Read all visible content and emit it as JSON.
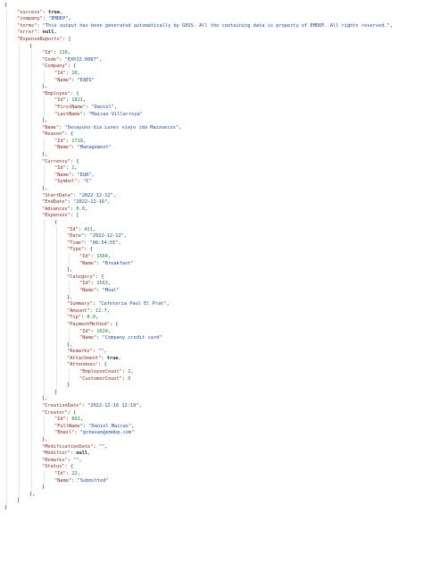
{
  "json_lines": [
    {
      "d": 0,
      "t": "{",
      "toggle": true
    },
    {
      "d": 1,
      "k": "success",
      "v": "true",
      "vt": "bool"
    },
    {
      "d": 1,
      "k": "company",
      "v": "\"EMDEP\"",
      "vt": "str"
    },
    {
      "d": 1,
      "k": "terms",
      "v": "\"This output has been generated automatically by GEOS. All the containing data is property of EMDEP. All rights reserved.\"",
      "vt": "str"
    },
    {
      "d": 1,
      "k": "error",
      "v": "null",
      "vt": "nul"
    },
    {
      "d": 1,
      "k": "ExpenseReports",
      "t": "[",
      "toggle": true
    },
    {
      "d": 2,
      "t": "{",
      "toggle": true
    },
    {
      "d": 3,
      "k": "Id",
      "v": "118",
      "vt": "num"
    },
    {
      "d": 3,
      "k": "Code",
      "v": "\"EXP22.0087\"",
      "vt": "str"
    },
    {
      "d": 3,
      "k": "Company",
      "t": "{",
      "toggle": true
    },
    {
      "d": 4,
      "k": "Id",
      "v": "10",
      "vt": "num"
    },
    {
      "d": 4,
      "k": "Name",
      "v": "\"EAES\"",
      "vt": "str",
      "last": true
    },
    {
      "d": 3,
      "t": "},"
    },
    {
      "d": 3,
      "k": "Employee",
      "t": "{",
      "toggle": true
    },
    {
      "d": 4,
      "k": "Id",
      "v": "1821",
      "vt": "num"
    },
    {
      "d": 4,
      "k": "FirstName",
      "v": "\"Daniel\"",
      "vt": "str"
    },
    {
      "d": 4,
      "k": "LastName",
      "v": "\"Maicas Villarroya\"",
      "vt": "str",
      "last": true
    },
    {
      "d": 3,
      "t": "},"
    },
    {
      "d": 3,
      "k": "Name",
      "v": "\"Desayuno dia Lunes viaje ida Mazzuecos\"",
      "vt": "str"
    },
    {
      "d": 3,
      "k": "Reason",
      "t": "{",
      "toggle": true
    },
    {
      "d": 4,
      "k": "Id",
      "v": "1719",
      "vt": "num"
    },
    {
      "d": 4,
      "k": "Name",
      "v": "\"Management\"",
      "vt": "str",
      "last": true
    },
    {
      "d": 3,
      "t": "},"
    },
    {
      "d": 3,
      "k": "Currency",
      "t": "{",
      "toggle": true
    },
    {
      "d": 4,
      "k": "Id",
      "v": "1",
      "vt": "num"
    },
    {
      "d": 4,
      "k": "Name",
      "v": "\"EUR\"",
      "vt": "str"
    },
    {
      "d": 4,
      "k": "Symbol",
      "v": "\"€\"",
      "vt": "str",
      "last": true
    },
    {
      "d": 3,
      "t": "},"
    },
    {
      "d": 3,
      "k": "StartDate",
      "v": "\"2022-12-12\"",
      "vt": "str"
    },
    {
      "d": 3,
      "k": "EndDate",
      "v": "\"2022-12-16\"",
      "vt": "str"
    },
    {
      "d": 3,
      "k": "Advances",
      "v": "0.0",
      "vt": "num"
    },
    {
      "d": 3,
      "k": "Expenses",
      "t": "[",
      "toggle": true
    },
    {
      "d": 4,
      "t": "{",
      "toggle": true
    },
    {
      "d": 5,
      "k": "Id",
      "v": "411",
      "vt": "num"
    },
    {
      "d": 5,
      "k": "Date",
      "v": "\"2022-12-12\"",
      "vt": "str"
    },
    {
      "d": 5,
      "k": "Time",
      "v": "\"06:54:55\"",
      "vt": "str"
    },
    {
      "d": 5,
      "k": "Type",
      "t": "{",
      "toggle": true
    },
    {
      "d": 6,
      "k": "Id",
      "v": "1564",
      "vt": "num"
    },
    {
      "d": 6,
      "k": "Name",
      "v": "\"Breakfast\"",
      "vt": "str",
      "last": true
    },
    {
      "d": 5,
      "t": "},"
    },
    {
      "d": 5,
      "k": "Category",
      "t": "{",
      "toggle": true
    },
    {
      "d": 6,
      "k": "Id",
      "v": "1563",
      "vt": "num"
    },
    {
      "d": 6,
      "k": "Name",
      "v": "\"Meal\"",
      "vt": "str",
      "last": true
    },
    {
      "d": 5,
      "t": "},"
    },
    {
      "d": 5,
      "k": "Summary",
      "v": "\"Cafeteria Paul El Prat\"",
      "vt": "str"
    },
    {
      "d": 5,
      "k": "Amount",
      "v": "12.7",
      "vt": "num"
    },
    {
      "d": 5,
      "k": "Tip",
      "v": "0.0",
      "vt": "num"
    },
    {
      "d": 5,
      "k": "PaymentMethod",
      "t": "{",
      "toggle": true
    },
    {
      "d": 6,
      "k": "Id",
      "v": "1624",
      "vt": "num"
    },
    {
      "d": 6,
      "k": "Name",
      "v": "\"Company credit card\"",
      "vt": "str",
      "last": true
    },
    {
      "d": 5,
      "t": "},"
    },
    {
      "d": 5,
      "k": "Remarks",
      "v": "\"\"",
      "vt": "str"
    },
    {
      "d": 5,
      "k": "Attachment",
      "v": "true",
      "vt": "bool"
    },
    {
      "d": 5,
      "k": "Attendees",
      "t": "{",
      "toggle": true
    },
    {
      "d": 6,
      "k": "EmployeeCount",
      "v": "2",
      "vt": "num"
    },
    {
      "d": 6,
      "k": "CustomerCount",
      "v": "0",
      "vt": "num",
      "last": true
    },
    {
      "d": 5,
      "t": "}"
    },
    {
      "d": 4,
      "t": "}"
    },
    {
      "d": 3,
      "t": "],"
    },
    {
      "d": 3,
      "k": "CreationDate",
      "v": "\"2022-12-16 12:19\"",
      "vt": "str"
    },
    {
      "d": 3,
      "k": "Creator",
      "t": "{",
      "toggle": true
    },
    {
      "d": 4,
      "k": "Id",
      "v": "891",
      "vt": "num"
    },
    {
      "d": 4,
      "k": "FullName",
      "v": "\"Daniel Maicas\"",
      "vt": "str"
    },
    {
      "d": 4,
      "k": "Email",
      "v": "\"gchavan@emdep.com\"",
      "vt": "str",
      "last": true
    },
    {
      "d": 3,
      "t": "},"
    },
    {
      "d": 3,
      "k": "ModificationDate",
      "v": "\"\"",
      "vt": "str"
    },
    {
      "d": 3,
      "k": "Modifier",
      "v": "null",
      "vt": "nul"
    },
    {
      "d": 3,
      "k": "Remarks",
      "v": "\"\"",
      "vt": "str"
    },
    {
      "d": 3,
      "k": "Status",
      "t": "{",
      "toggle": true
    },
    {
      "d": 4,
      "k": "Id",
      "v": "22",
      "vt": "num"
    },
    {
      "d": 4,
      "k": "Name",
      "v": "\"Submitted\"",
      "vt": "str",
      "last": true
    },
    {
      "d": 3,
      "t": "}"
    },
    {
      "d": 2,
      "t": "},"
    },
    {
      "d": 1,
      "t": "]"
    },
    {
      "d": 0,
      "t": "}"
    }
  ]
}
